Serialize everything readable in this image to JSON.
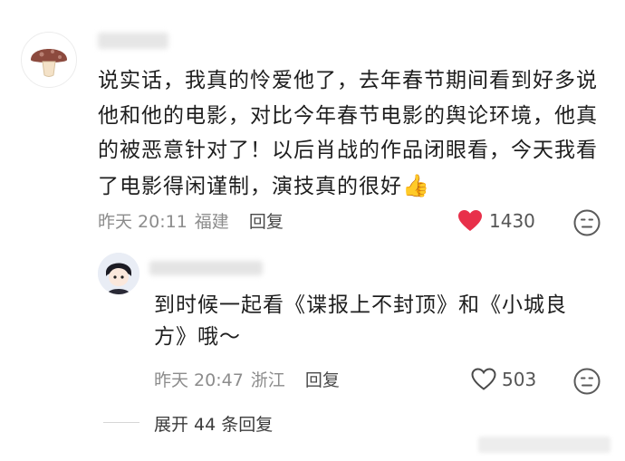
{
  "comment": {
    "text": "说实话，我真的怜爱他了，去年春节期间看到好多说他和他的电影，对比今年春节电影的舆论环境，他真的被恶意针对了！以后肖战的作品闭眼看，今天我看了电影得闲谨制，演技真的很好",
    "emoji": "👍",
    "time": "昨天 20:11",
    "location": "福建",
    "reply_label": "回复",
    "likes": "1430",
    "liked": true,
    "like_color": "#e8304a"
  },
  "reply": {
    "text": "到时候一起看《谍报上不封顶》和《小城良方》哦～",
    "time": "昨天 20:47",
    "location": "浙江",
    "reply_label": "回复",
    "likes": "503",
    "liked": false
  },
  "expand_label": "展开 44 条回复",
  "icons": {
    "avatar1": "mushroom-avatar-icon",
    "avatar2": "cartoon-avatar-icon",
    "liked_heart": "heart-filled-icon",
    "heart": "heart-outline-icon",
    "emoji_button": "face-emoji-icon",
    "thumbs": "thumbs-up-emoji"
  }
}
